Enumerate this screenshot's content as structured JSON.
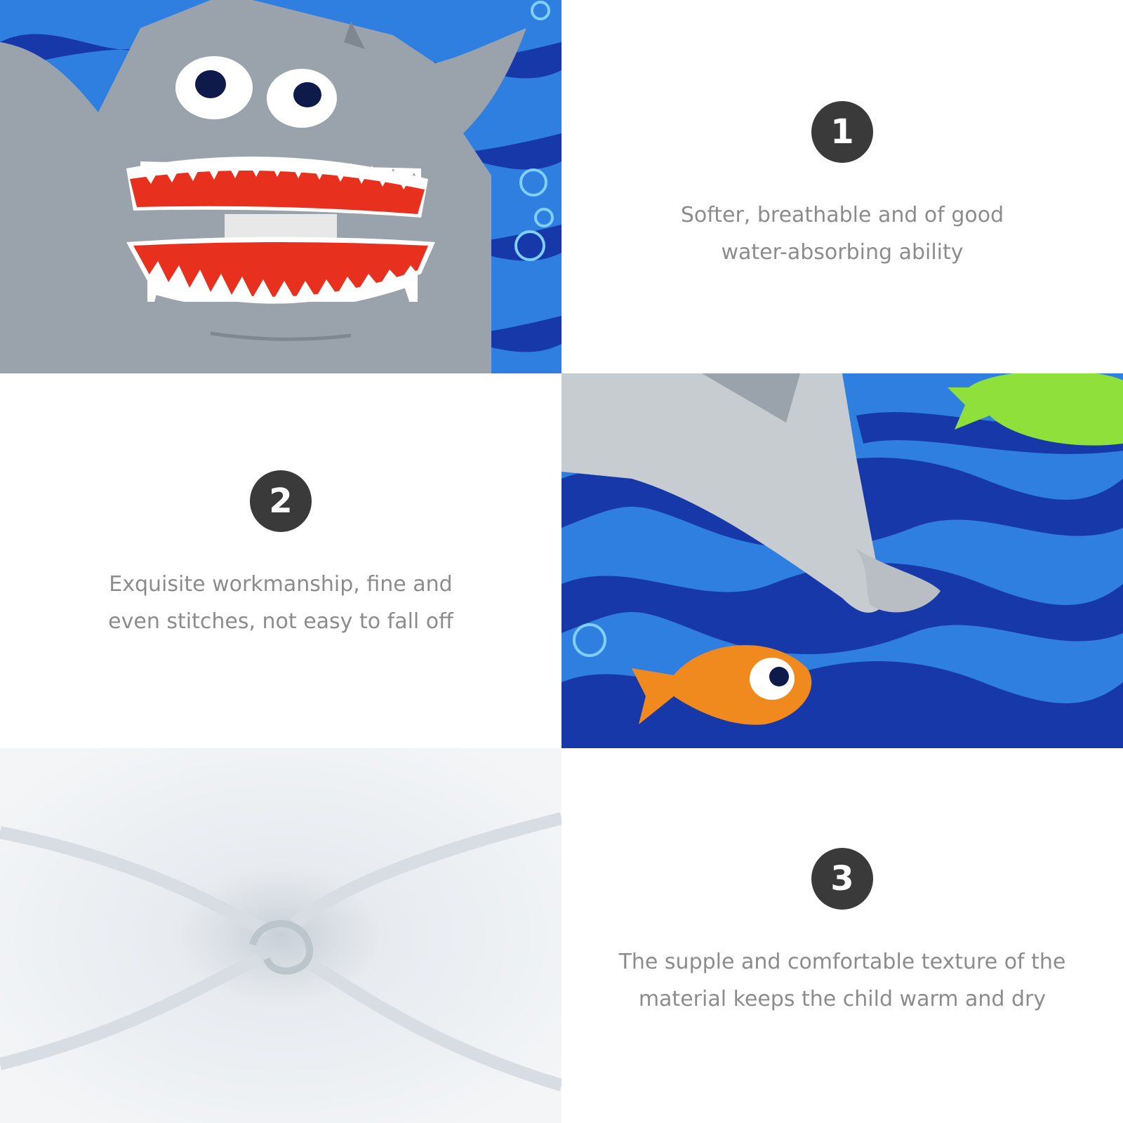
{
  "features": [
    {
      "number": "1",
      "caption_line1": "Softer, breathable and of good",
      "caption_line2": "water-absorbing ability"
    },
    {
      "number": "2",
      "caption_line1": "Exquisite workmanship, fine and",
      "caption_line2": "even stitches, not easy to fall off"
    },
    {
      "number": "3",
      "caption_line1": "The supple and comfortable texture of the",
      "caption_line2": "material keeps the child warm and dry"
    }
  ],
  "colors": {
    "badge": "#3a3a3a",
    "caption": "#8c8c8c",
    "ocean_light": "#2f7fe0",
    "ocean_dark": "#1638a8",
    "shark_gray": "#9aa3ab",
    "mouth_red": "#e8301e",
    "fish_orange": "#f08a1e",
    "fish_green": "#8fe03a"
  },
  "images": {
    "shark_hood": "shark-hood-photo",
    "ocean_fold": "ocean-print-fold-photo",
    "white_lining": "white-terry-lining-photo"
  }
}
